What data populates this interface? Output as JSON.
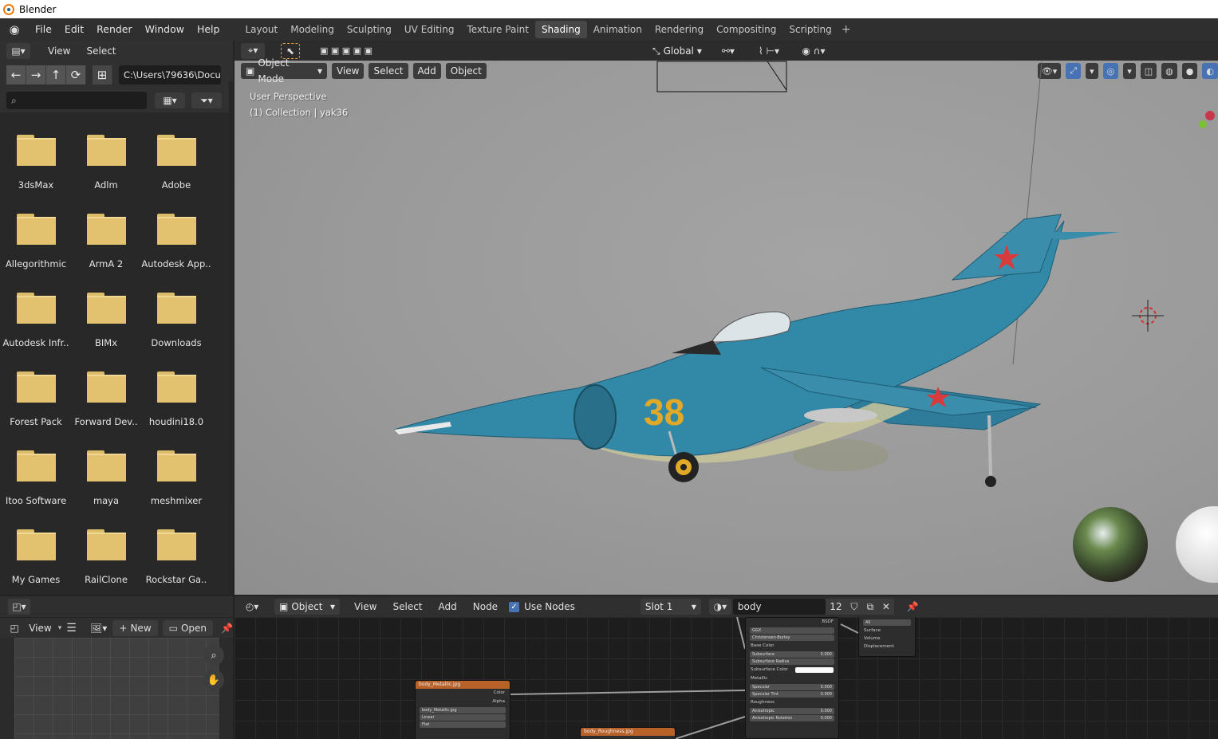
{
  "window": {
    "title": "Blender"
  },
  "menubar": {
    "items": [
      "File",
      "Edit",
      "Render",
      "Window",
      "Help"
    ]
  },
  "workspaces": {
    "tabs": [
      "Layout",
      "Modeling",
      "Sculpting",
      "UV Editing",
      "Texture Paint",
      "Shading",
      "Animation",
      "Rendering",
      "Compositing",
      "Scripting"
    ],
    "active": "Shading",
    "add": "+"
  },
  "file_browser": {
    "menus": [
      "View",
      "Select"
    ],
    "path": "C:\\Users\\79636\\Docu..",
    "folders": [
      "3dsMax",
      "Adlm",
      "Adobe",
      "Allegorithmic",
      "ArmA 2",
      "Autodesk App..",
      "Autodesk Infr..",
      "BIMx",
      "Downloads",
      "Forest Pack",
      "Forward Dev..",
      "houdini18.0",
      "Itoo Software",
      "maya",
      "meshmixer",
      "My Games",
      "RailClone",
      "Rockstar Ga.."
    ]
  },
  "viewport": {
    "transform_orientation": "Global",
    "mode": "Object Mode",
    "menus": [
      "View",
      "Select",
      "Add",
      "Object"
    ],
    "info_line1": "User Perspective",
    "info_line2": "(1) Collection | yak36",
    "aircraft_number": "38"
  },
  "node_editor": {
    "type_label": "Object",
    "menus": [
      "View",
      "Select",
      "Add",
      "Node"
    ],
    "use_nodes_label": "Use Nodes",
    "use_nodes_checked": true,
    "slot": "Slot 1",
    "material": "body",
    "user_count": "12",
    "nodes": {
      "metallic": {
        "title": "body_Metallic.jpg",
        "out_color": "Color",
        "out_alpha": "Alpha",
        "image": "body_Metallic.jpg",
        "interp": "Linear",
        "proj": "Flat"
      },
      "roughness": {
        "title": "body_Roughness.jpg"
      },
      "bsdf": {
        "title": "BSDF",
        "distribution": "GGX",
        "subsurface_method": "Christensen-Burley",
        "rows": [
          {
            "label": "Base Color",
            "value": ""
          },
          {
            "label": "Subsurface",
            "value": "0.000"
          },
          {
            "label": "Subsurface Radius",
            "value": ""
          },
          {
            "label": "Subsurface Color",
            "value": ""
          },
          {
            "label": "Metallic",
            "value": ""
          },
          {
            "label": "Specular",
            "value": "0.000"
          },
          {
            "label": "Specular Tint",
            "value": "0.000"
          },
          {
            "label": "Roughness",
            "value": ""
          },
          {
            "label": "Anisotropic",
            "value": "0.000"
          },
          {
            "label": "Anisotropic Rotation",
            "value": "0.000"
          }
        ]
      },
      "output": {
        "target": "All",
        "inputs": [
          "Surface",
          "Volume",
          "Displacement"
        ]
      }
    }
  },
  "image_editor": {
    "view_menu": "View",
    "new_label": "New",
    "open_label": "Open"
  },
  "colors": {
    "active_tab": "#474747",
    "accent": "#4772b3",
    "folder": "#e2c26f",
    "node_texture_header": "#b8622a"
  }
}
